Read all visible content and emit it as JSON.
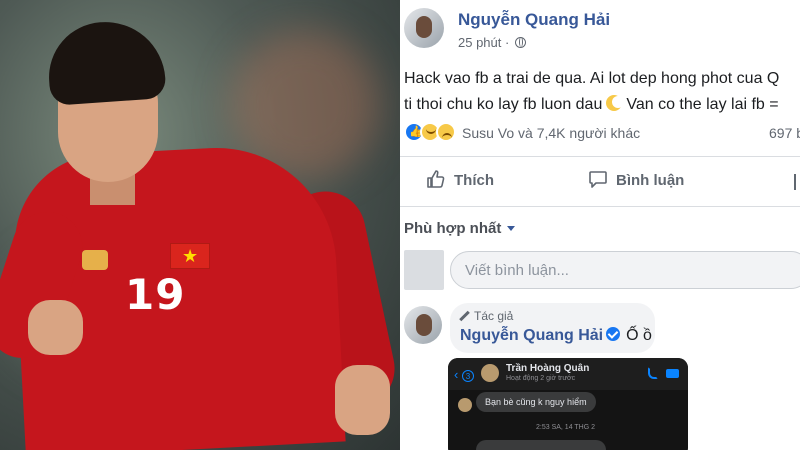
{
  "post": {
    "author": "Nguyễn Quang Hải",
    "time": "25 phút",
    "text_line1": "Hack vao fb a trai de qua. Ai lot dep hong phot cua Q",
    "text_line2a": "ti thoi chu ko lay fb luon dau",
    "text_line2b": "Van co the lay lai fb ="
  },
  "reactions": {
    "summary": "Susu Vo và 7,4K người khác",
    "comments_count": "697 b"
  },
  "actions": {
    "like_label": "Thích",
    "comment_label": "Bình luận"
  },
  "comments": {
    "sort_label": "Phù hợp nhất",
    "input_placeholder": "Viết bình luận...",
    "top_comment": {
      "badge": "Tác giả",
      "author": "Nguyễn Quang Hải",
      "text": "Ố ồ"
    }
  },
  "chat_screenshot": {
    "back_count": "3",
    "name": "Trần Hoàng Quân",
    "status": "Hoạt động 2 giờ trước",
    "message": "Bạn bè cũng k nguy hiểm",
    "timestamp": "2:53 SA, 14 THG 2"
  },
  "photo": {
    "jersey_number": "19"
  },
  "colors": {
    "link_blue": "#385898",
    "like_blue": "#1877f2",
    "jersey_red": "#c5161d"
  }
}
